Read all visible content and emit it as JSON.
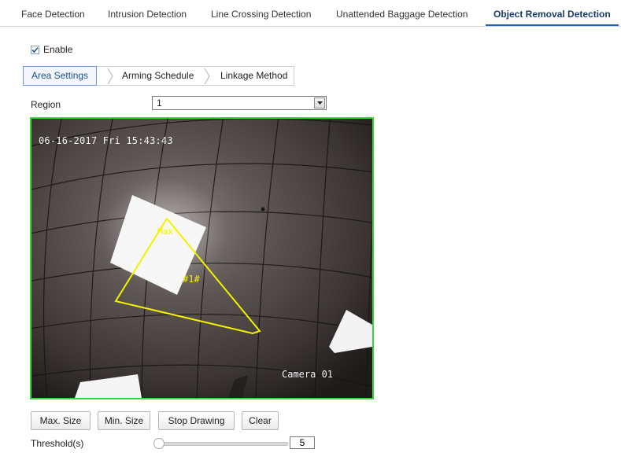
{
  "top_tabs": [
    {
      "label": "Face Detection"
    },
    {
      "label": "Intrusion Detection"
    },
    {
      "label": "Line Crossing Detection"
    },
    {
      "label": "Unattended Baggage Detection"
    },
    {
      "label": "Object Removal Detection",
      "active": true
    }
  ],
  "enable": {
    "label": "Enable",
    "checked": true
  },
  "sub_tabs": [
    {
      "label": "Area Settings",
      "active": true
    },
    {
      "label": "Arming Schedule"
    },
    {
      "label": "Linkage Method"
    }
  ],
  "region": {
    "label": "Region",
    "value": "1"
  },
  "video": {
    "timestamp": "06-16-2017 Fri 15:43:43",
    "camera_name": "Camera 01",
    "region_label": "#1#",
    "max_label": "Max",
    "border_color": "#39d63b",
    "region_color": "#f2f200"
  },
  "buttons": {
    "max_size": "Max. Size",
    "min_size": "Min. Size",
    "stop_drawing": "Stop Drawing",
    "clear": "Clear"
  },
  "threshold": {
    "label": "Threshold(s)",
    "value": "5",
    "level_fraction": 0.0
  },
  "colors": {
    "accent": "#1d5fb3",
    "active_tab_text": "#1b3a66"
  }
}
